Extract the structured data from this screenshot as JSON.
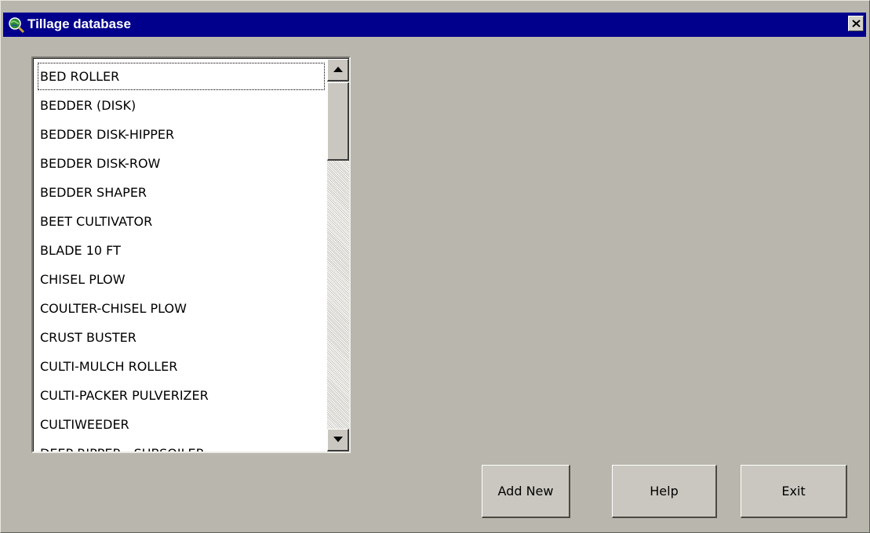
{
  "window": {
    "title": "Tillage database",
    "title_icon": "globe-magnifier-icon",
    "close_icon": "close-icon",
    "colors": {
      "titlebar": "#00008c",
      "face": "#b9b7ad",
      "list_bg": "#ffffff"
    }
  },
  "list": {
    "selected_index": 0,
    "items": [
      "BED ROLLER",
      "BEDDER (DISK)",
      "BEDDER DISK-HIPPER",
      "BEDDER DISK-ROW",
      "BEDDER SHAPER",
      "BEET CULTIVATOR",
      "BLADE 10 FT",
      "CHISEL PLOW",
      "COULTER-CHISEL PLOW",
      "CRUST BUSTER",
      "CULTI-MULCH ROLLER",
      "CULTI-PACKER PULVERIZER",
      "CULTIWEEDER",
      "DEEP RIPPER - SUBSOILER"
    ],
    "scrollbar": {
      "up_icon": "arrow-up-icon",
      "down_icon": "arrow-down-icon"
    }
  },
  "buttons": {
    "add_new": "Add New",
    "help": "Help",
    "exit": "Exit"
  }
}
